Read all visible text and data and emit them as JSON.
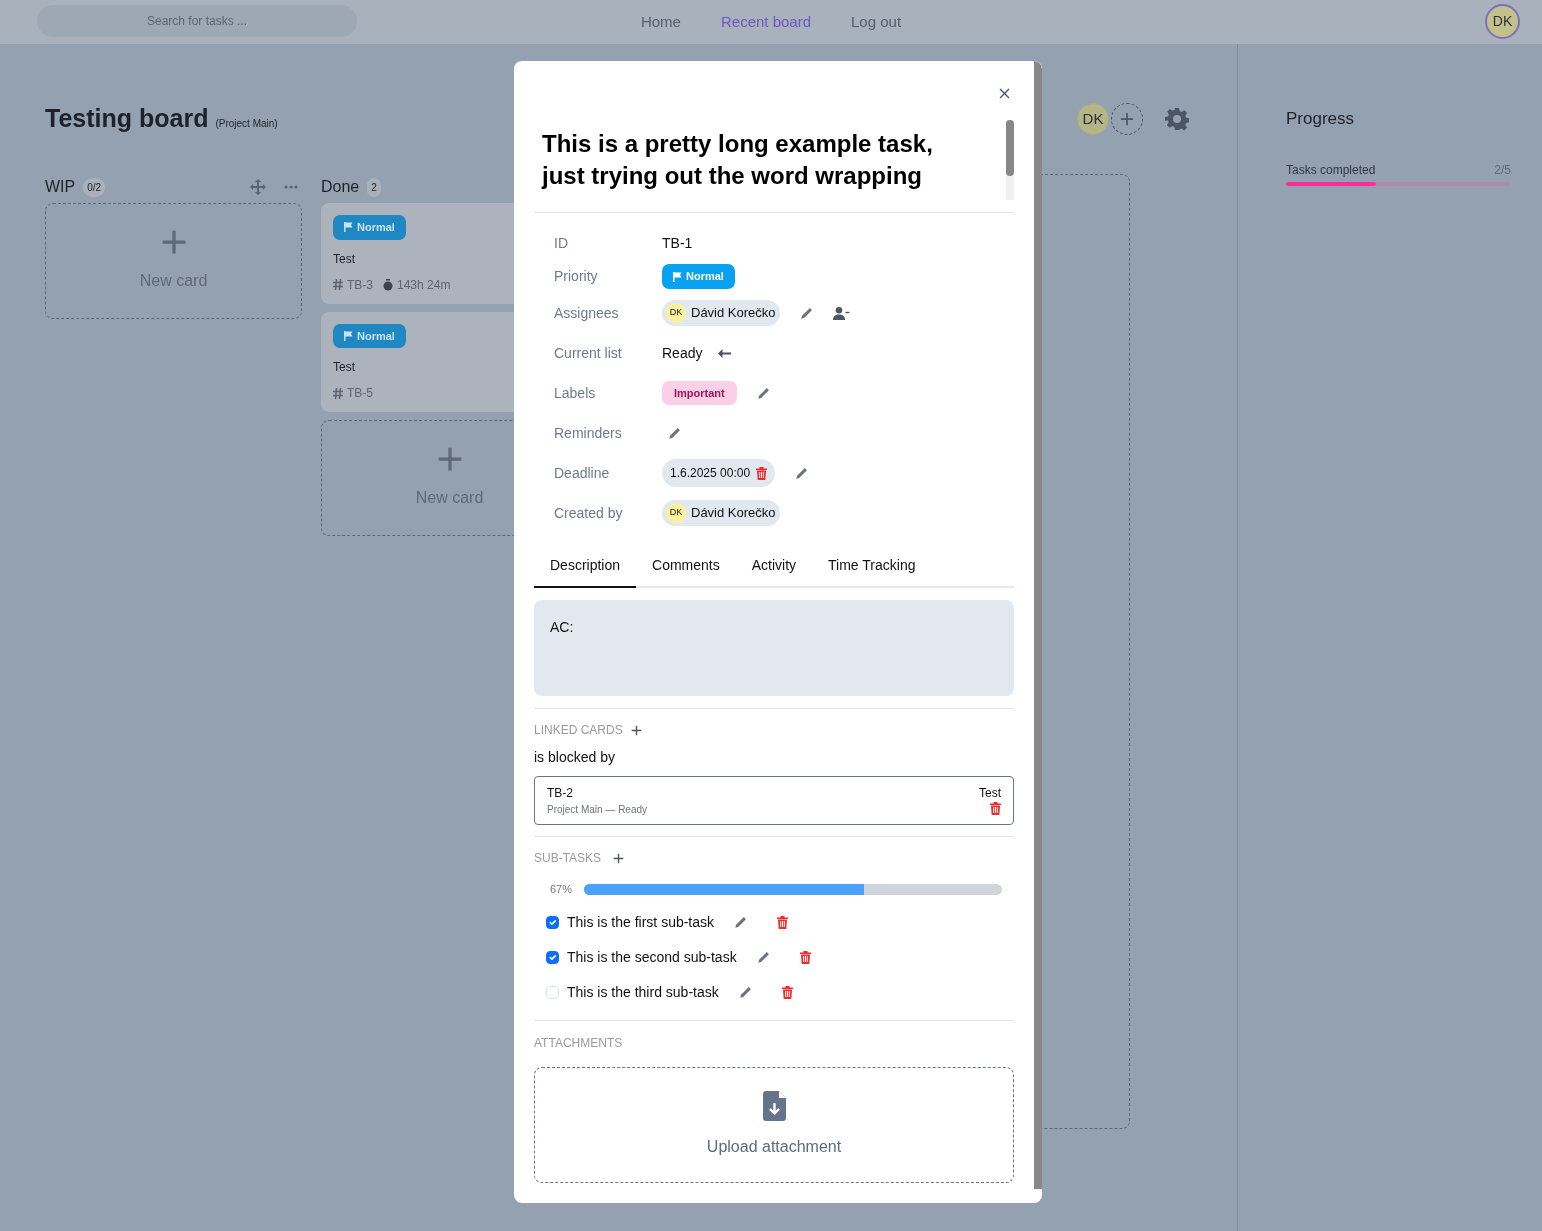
{
  "search": {
    "placeholder": "Search for tasks ..."
  },
  "nav": [
    {
      "label": "Home",
      "selected": false
    },
    {
      "label": "Recent board",
      "selected": true
    },
    {
      "label": "Log out",
      "selected": false
    }
  ],
  "user": {
    "initials": "DK"
  },
  "board": {
    "title": "Testing board",
    "project": "(Project Main)",
    "members": [
      {
        "initials": "DK"
      }
    ],
    "columns": [
      {
        "name": "WIP",
        "count": "0/2",
        "movable": true,
        "new_card": "New card"
      },
      {
        "name": "Done",
        "count": "2",
        "cards": [
          {
            "priority": "Normal",
            "title": "Test",
            "id": "TB-3",
            "time": "143h 24m"
          },
          {
            "priority": "Normal",
            "title": "Test",
            "id": "TB-5"
          }
        ],
        "new_card": "New card"
      }
    ]
  },
  "progress": {
    "title": "Progress",
    "items": [
      {
        "label": "Tasks completed",
        "value": "2/5",
        "level": 0.4
      }
    ]
  },
  "task": {
    "title": "This is a pretty long example task, just trying out the word wrapping",
    "fields": [
      {
        "label": "ID",
        "kind": "text",
        "value": "TB-1"
      },
      {
        "label": "Priority",
        "kind": "priority",
        "value": "Normal"
      },
      {
        "label": "Assignees",
        "kind": "assignees",
        "users": [
          {
            "initials": "DK",
            "name": "Dávid Korečko"
          }
        ]
      },
      {
        "label": "Current list",
        "kind": "list",
        "value": "Ready"
      },
      {
        "label": "Labels",
        "kind": "labels",
        "labels": [
          {
            "text": "Important",
            "color": "#fbcfe8"
          }
        ]
      },
      {
        "label": "Reminders",
        "kind": "reminders"
      },
      {
        "label": "Deadline",
        "kind": "date",
        "value": "1.6.2025 00:00"
      },
      {
        "label": "Created by",
        "kind": "creator",
        "users": [
          {
            "initials": "DK",
            "name": "Dávid Korečko"
          }
        ]
      }
    ],
    "tabs": [
      {
        "label": "Description",
        "selected": true
      },
      {
        "label": "Comments",
        "selected": false
      },
      {
        "label": "Activity",
        "selected": false
      },
      {
        "label": "Time Tracking",
        "selected": false
      }
    ],
    "description": "AC:",
    "linked": {
      "heading": "LINKED CARDS",
      "relation": "is blocked by",
      "cards": [
        {
          "id": "TB-2",
          "meta": "Project Main — Ready",
          "title": "Test"
        }
      ]
    },
    "subtasks": {
      "heading": "SUB-TASKS",
      "percent": "67%",
      "level": 0.67,
      "items": [
        {
          "text": "This is the first sub-task",
          "checked": true
        },
        {
          "text": "This is the second sub-task",
          "checked": true
        },
        {
          "text": "This is the third sub-task",
          "checked": false
        }
      ]
    },
    "attachments": {
      "heading": "ATTACHMENTS",
      "upload": "Upload attachment"
    }
  }
}
